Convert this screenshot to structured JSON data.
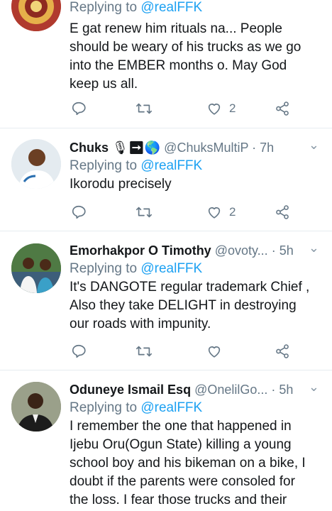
{
  "tweets": [
    {
      "name": "",
      "handle": "",
      "time": "",
      "reply_prefix": "Replying to ",
      "reply_mention": "@realFFK",
      "lines": [
        "E gat renew him rituals na... People",
        "should be weary of his trucks as we go",
        "into the EMBER months o. May God",
        "keep us all."
      ],
      "reply_count": "",
      "retweet_count": "",
      "like_count": "2"
    },
    {
      "name": "Chuks",
      "emoji": "🎙➡🌎",
      "handle": "@ChuksMultiP",
      "time": "· 7h",
      "reply_prefix": "Replying to ",
      "reply_mention": "@realFFK",
      "lines": [
        "Ikorodu precisely"
      ],
      "reply_count": "",
      "retweet_count": "",
      "like_count": "2"
    },
    {
      "name": "Emorhakpor O Timothy",
      "handle": "@ovoty...",
      "time": "· 5h",
      "reply_prefix": "Replying to ",
      "reply_mention": "@realFFK",
      "lines": [
        "It's DANGOTE regular trademark Chief ,",
        "Also they take DELIGHT in destroying",
        "our roads with impunity."
      ],
      "reply_count": "",
      "retweet_count": "",
      "like_count": ""
    },
    {
      "name": "Oduneye Ismail Esq",
      "handle": "@OnelilGo...",
      "time": "· 5h",
      "reply_prefix": "Replying to ",
      "reply_mention": "@realFFK",
      "lines": [
        "I remember the one that happened in",
        "Ijebu Oru(Ogun State) killing a young",
        "school boy and his bikeman on a bike, I",
        "doubt if the parents were consoled for",
        "the loss. I fear those trucks and their"
      ],
      "reply_count": "",
      "retweet_count": "",
      "like_count": ""
    }
  ],
  "icons": {
    "reply": "reply-icon",
    "retweet": "retweet-icon",
    "like": "heart-icon",
    "share": "share-icon",
    "caret": "chevron-down-icon"
  },
  "colors": {
    "link": "#1da1f2",
    "secondary": "#657786",
    "text": "#14171a",
    "divider": "#e6ecf0"
  }
}
